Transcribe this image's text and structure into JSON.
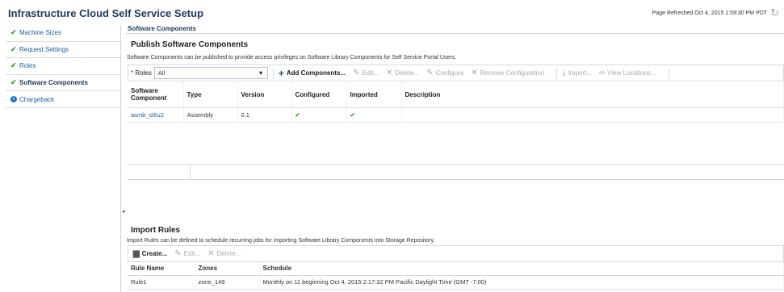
{
  "header": {
    "title": "Infrastructure Cloud Self Service Setup",
    "refresh_text": "Page Refreshed Oct 4, 2015 1:59:30 PM PDT",
    "refresh_icon": "refresh-icon"
  },
  "sidebar": {
    "items": [
      {
        "label": "Machine Sizes",
        "icon": "check-icon",
        "active": false
      },
      {
        "label": "Request Settings",
        "icon": "check-icon",
        "active": false
      },
      {
        "label": "Roles",
        "icon": "check-icon",
        "active": false
      },
      {
        "label": "Software Components",
        "icon": "check-icon",
        "active": true
      },
      {
        "label": "Chargeback",
        "icon": "info-icon",
        "active": false
      }
    ]
  },
  "main": {
    "section_title": "Software Components",
    "panel_title": "Publish Software Components",
    "panel_desc": "Software Components can be published to provide access privileges on Software Library Components for Self Service Portal Users.",
    "roles_label": "Roles",
    "roles_value": "All",
    "toolbar": {
      "add": "Add Components...",
      "edit": "Edit...",
      "delete": "Delete...",
      "configure": "Configure",
      "remove_config": "Remove Configuration",
      "import": "Import...",
      "view_locations": "View Locations..."
    },
    "table": {
      "col_component": "Software Component",
      "col_type": "Type",
      "col_version": "Version",
      "col_configured": "Configured",
      "col_imported": "Imported",
      "col_description": "Description",
      "rows": [
        {
          "component": "asmb_ol6u2",
          "type": "Assembly",
          "version": "0.1",
          "configured": "✔",
          "imported": "✔",
          "description": ""
        }
      ]
    }
  },
  "import_rules": {
    "title": "Import Rules",
    "desc": "Import Rules can be defined to schedule recurring jobs for importing Software Library Components into Storage Repository.",
    "toolbar": {
      "create": "Create...",
      "edit": "Edit...",
      "delete": "Delete..."
    },
    "table": {
      "col_rule": "Rule Name",
      "col_zones": "Zones",
      "col_schedule": "Schedule",
      "rows": [
        {
          "rule": "Rule1",
          "zones": "zone_149",
          "schedule": "Monthly on 11 beginning Oct 4, 2015 2:17:32 PM Pacific Daylight Time (GMT -7:00)"
        }
      ]
    }
  },
  "colors": {
    "accent": "#213a5c",
    "link": "#1f5a9c",
    "success": "#3f9e2b"
  }
}
